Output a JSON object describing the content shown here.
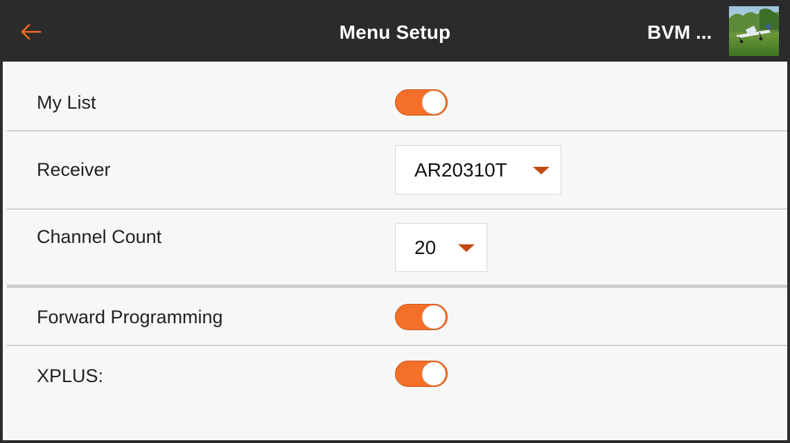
{
  "header": {
    "title": "Menu Setup",
    "model_name": "BVM ...",
    "back_icon": "arrow-left-icon",
    "accent_color": "#f26b22"
  },
  "settings": {
    "my_list": {
      "label": "My List",
      "enabled": true
    },
    "receiver": {
      "label": "Receiver",
      "value": "AR20310T"
    },
    "channel_count": {
      "label": "Channel Count",
      "value": "20"
    },
    "forward_programming": {
      "label": "Forward Programming",
      "enabled": true
    },
    "xplus": {
      "label": "XPLUS:",
      "enabled": true
    }
  },
  "colors": {
    "toggle_on": "#f47028",
    "caret": "#c44a12",
    "header_bg": "#2b2b2b",
    "page_bg": "#f7f7f7"
  }
}
